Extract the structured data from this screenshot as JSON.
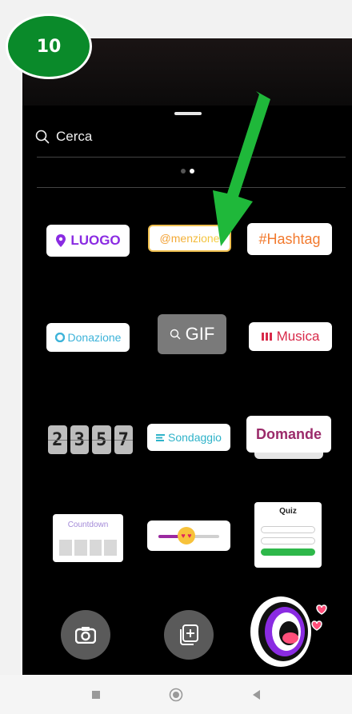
{
  "step": {
    "number": "10"
  },
  "search": {
    "label": "Cerca"
  },
  "pager": {
    "pages": 2,
    "active": 1
  },
  "stickers": {
    "location": "LUOGO",
    "mention": "@menzione",
    "hashtag": "#Hashtag",
    "donation": "Donazione",
    "gif": "GIF",
    "music": "Musica",
    "countdown_digits": [
      "2",
      "3",
      "5",
      "7"
    ],
    "poll": "Sondaggio",
    "questions": "Domande",
    "countdown": "Countdown",
    "quiz": "Quiz",
    "slider_emoji": "heart-eyes-emoji"
  },
  "bottom_actions": {
    "camera": "camera-icon",
    "add": "add-media-icon",
    "mic": "shout-mouth-sticker"
  },
  "colors": {
    "badge": "#0a8a2a",
    "arrow": "#1fb83a",
    "location": "#8a2be2",
    "hashtag": "#f27a2e",
    "music": "#d82a4a",
    "questions": "#9b2a6a"
  },
  "navbar": [
    "recent-apps-icon",
    "home-icon",
    "back-icon"
  ]
}
